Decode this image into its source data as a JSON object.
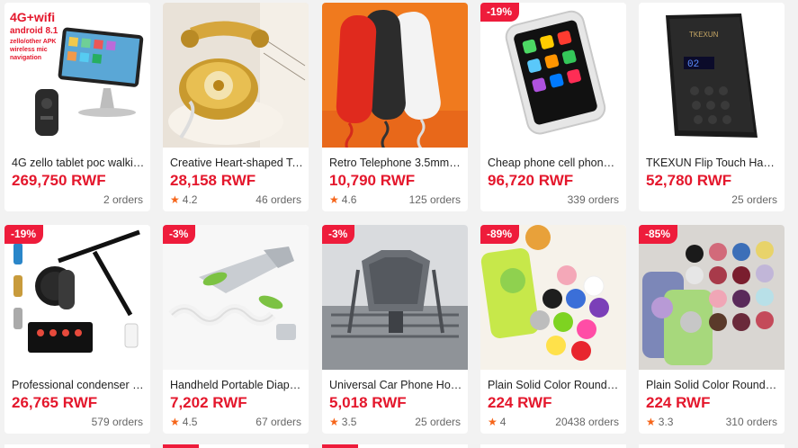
{
  "colors": {
    "accent": "#e4172c",
    "badge": "#ee1c3b",
    "star": "#f6651a",
    "background": "#f2f2f2"
  },
  "products": [
    {
      "title": "4G zello tablet poc walkie t...",
      "price": "269,750 RWF",
      "rating": "",
      "orders": "2 orders",
      "badge": "",
      "image_text": {
        "line1": "4G+wifi",
        "line2": "android 8.1",
        "line3": "zello/other APK",
        "line4": "wireless mic",
        "line5": "navigation"
      }
    },
    {
      "title": "Creative Heart-shaped Tel...",
      "price": "28,158 RWF",
      "rating": "4.2",
      "orders": "46 orders",
      "badge": ""
    },
    {
      "title": "Retro Telephone 3.5mm R...",
      "price": "10,790 RWF",
      "rating": "4.6",
      "orders": "125 orders",
      "badge": ""
    },
    {
      "title": "Cheap phone cell phone 2....",
      "price": "96,720 RWF",
      "rating": "",
      "orders": "339 orders",
      "badge": "-19%"
    },
    {
      "title": "TKEXUN Flip Touch Hand...",
      "price": "52,780 RWF",
      "rating": "",
      "orders": "25 orders",
      "badge": "",
      "image_text": {
        "brand": "TKEXUN",
        "display": "02"
      }
    },
    {
      "title": "Professional condenser mi...",
      "price": "26,765 RWF",
      "rating": "",
      "orders": "579 orders",
      "badge": "-19%"
    },
    {
      "title": "Handheld Portable Diaper ...",
      "price": "7,202 RWF",
      "rating": "4.5",
      "orders": "67 orders",
      "badge": "-3%"
    },
    {
      "title": "Universal Car Phone Hold...",
      "price": "5,018 RWF",
      "rating": "3.5",
      "orders": "25 orders",
      "badge": "-3%"
    },
    {
      "title": "Plain Solid Color Round P...",
      "price": "224 RWF",
      "rating": "4",
      "orders": "20438 orders",
      "badge": "-89%"
    },
    {
      "title": "Plain Solid Color Round P...",
      "price": "224 RWF",
      "rating": "3.3",
      "orders": "310 orders",
      "badge": "-85%"
    }
  ]
}
